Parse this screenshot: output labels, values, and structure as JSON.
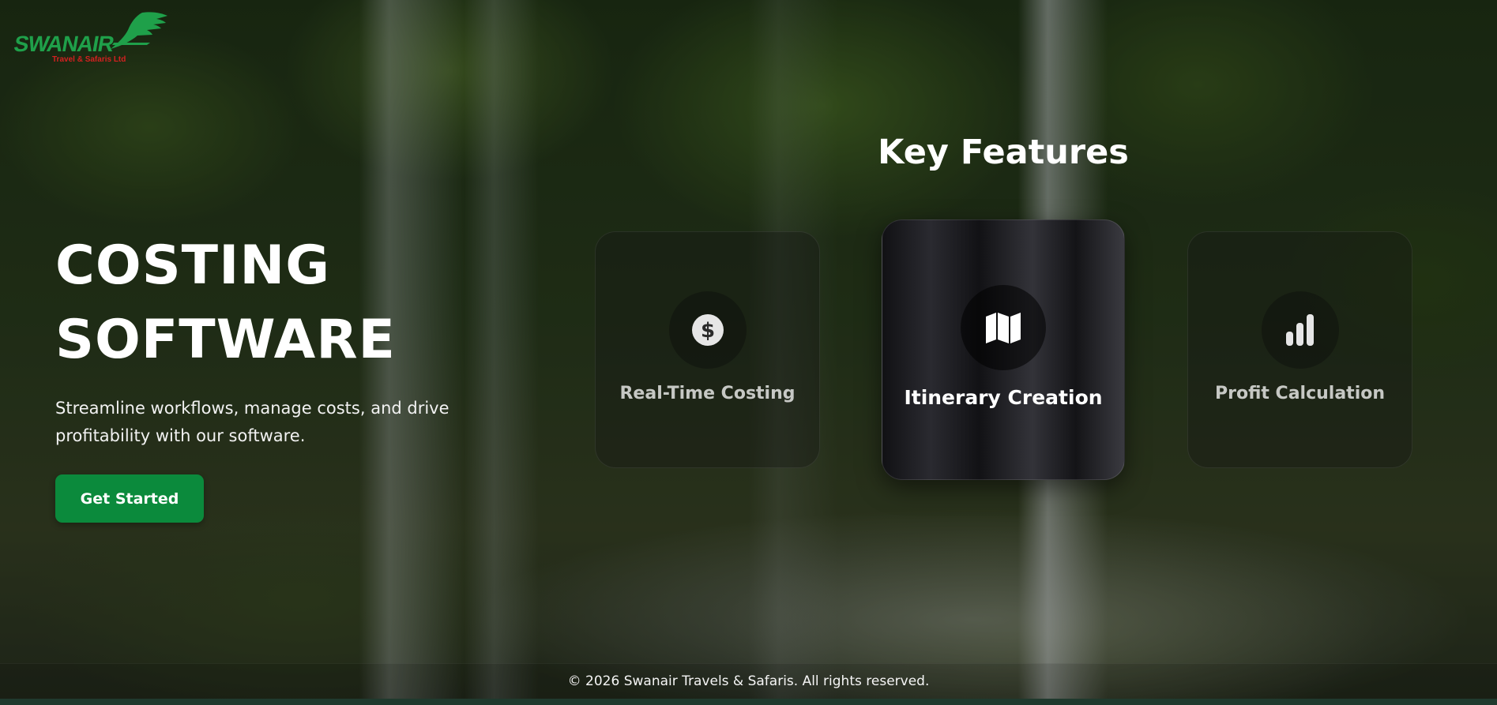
{
  "brand": {
    "name": "SWANAIR",
    "tagline": "Travel & Safaris Ltd",
    "colors": {
      "primary_green": "#1fa04a",
      "tagline_red": "#d42020"
    },
    "icon": "swan-wing-logo"
  },
  "hero": {
    "title_line1": "COSTING",
    "title_line2": "SOFTWARE",
    "subtitle": "Streamline workflows, manage costs, and drive profitability with our software.",
    "cta_label": "Get Started",
    "cta_color": "#0b8a3c"
  },
  "features": {
    "title": "Key Features",
    "items": [
      {
        "label": "Real-Time Costing",
        "icon": "dollar-icon"
      },
      {
        "label": "Itinerary Creation",
        "icon": "map-icon"
      },
      {
        "label": "Profit Calculation",
        "icon": "bar-chart-icon"
      }
    ]
  },
  "footer": {
    "copyright": "© 2026 Swanair Travels & Safaris. All rights reserved."
  }
}
